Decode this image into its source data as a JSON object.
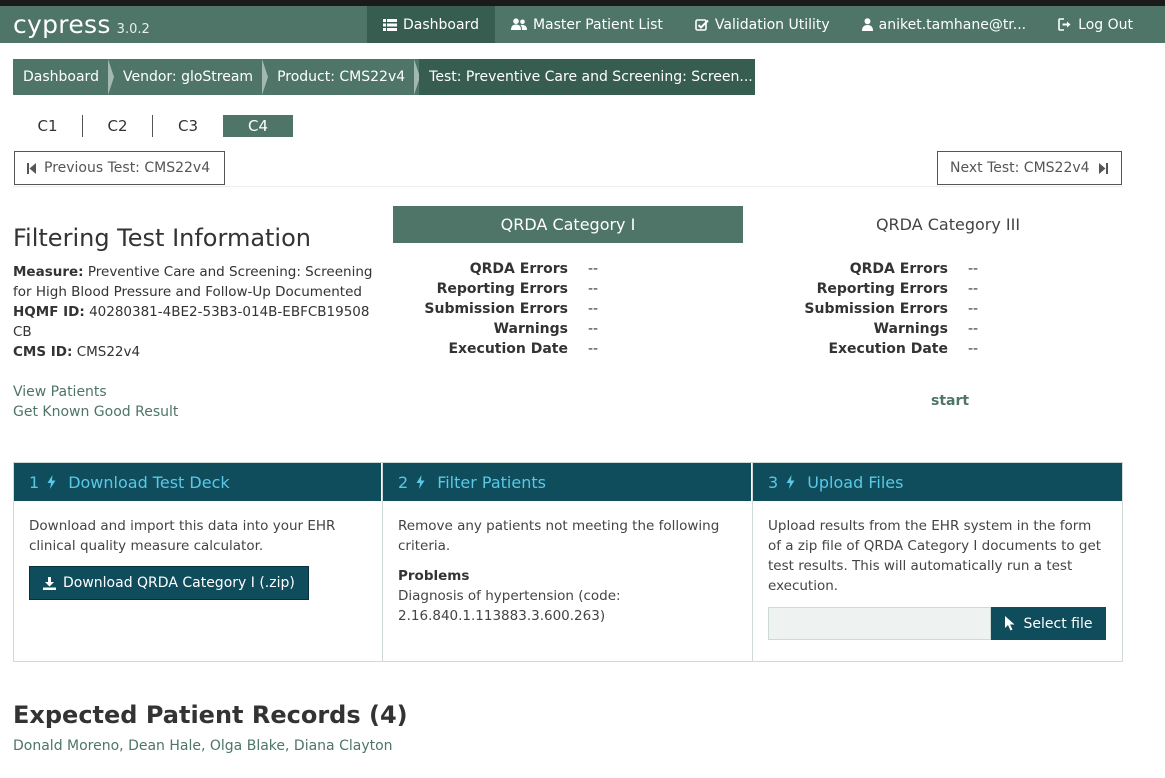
{
  "app": {
    "name": "cypress",
    "version": "3.0.2"
  },
  "nav": [
    {
      "label": "Dashboard",
      "icon": "list-icon",
      "active": true
    },
    {
      "label": "Master Patient List",
      "icon": "users-icon"
    },
    {
      "label": "Validation Utility",
      "icon": "check-square-icon"
    },
    {
      "label": "aniket.tamhane@tr...",
      "icon": "user-icon"
    },
    {
      "label": "Log Out",
      "icon": "sign-out-icon"
    }
  ],
  "breadcrumb": [
    "Dashboard",
    "Vendor: gloStream",
    "Product: CMS22v4",
    "Test: Preventive Care and Screening: Screen..."
  ],
  "ctabs": [
    "C1",
    "C2",
    "C3",
    "C4"
  ],
  "pager": {
    "prev": "Previous Test: CMS22v4",
    "next": "Next Test: CMS22v4"
  },
  "filtering": {
    "title": "Filtering Test Information",
    "measure_label": "Measure:",
    "measure": "Preventive Care and Screening: Screening for High Blood Pressure and Follow-Up Documented",
    "hqmf_label": "HQMF ID:",
    "hqmf": "40280381-4BE2-53B3-014B-EBFCB19508CB",
    "cms_label": "CMS ID:",
    "cms": "CMS22v4",
    "view_patients": "View Patients",
    "known_good": "Get Known Good Result"
  },
  "qrda1": {
    "title": "QRDA Category I",
    "rows": [
      {
        "label": "QRDA Errors",
        "value": "--"
      },
      {
        "label": "Reporting Errors",
        "value": "--"
      },
      {
        "label": "Submission Errors",
        "value": "--"
      },
      {
        "label": "Warnings",
        "value": "--"
      },
      {
        "label": "Execution Date",
        "value": "--"
      }
    ]
  },
  "qrda3": {
    "title": "QRDA Category III",
    "rows": [
      {
        "label": "QRDA Errors",
        "value": "--"
      },
      {
        "label": "Reporting Errors",
        "value": "--"
      },
      {
        "label": "Submission Errors",
        "value": "--"
      },
      {
        "label": "Warnings",
        "value": "--"
      },
      {
        "label": "Execution Date",
        "value": "--"
      }
    ],
    "start": "start"
  },
  "steps": {
    "download": {
      "num": "1",
      "title": "Download Test Deck",
      "text": "Download and import this data into your EHR clinical quality measure calculator.",
      "button": "Download QRDA Category I (.zip)"
    },
    "filter": {
      "num": "2",
      "title": "Filter Patients",
      "text": "Remove any patients not meeting the following criteria.",
      "problems_label": "Problems",
      "problems_text": "Diagnosis of hypertension (code: 2.16.840.1.113883.3.600.263)"
    },
    "upload": {
      "num": "3",
      "title": "Upload Files",
      "text": "Upload results from the EHR system in the form of a zip file of QRDA Category I documents to get test results. This will automatically run a test execution.",
      "button": "Select file",
      "file_value": ""
    }
  },
  "expected": {
    "title": "Expected Patient Records (4)",
    "patients": [
      "Donald Moreno",
      "Dean Hale",
      "Olga Blake",
      "Diana Clayton"
    ]
  },
  "colors": {
    "primary": "#4e7568",
    "primary_dark": "#375c50",
    "step_header": "#0f4c5c",
    "step_title": "#5bc8e6"
  }
}
